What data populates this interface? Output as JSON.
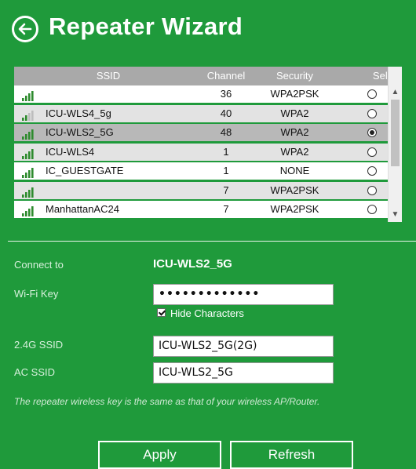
{
  "header": {
    "title": "Repeater Wizard",
    "back_icon": "back-arrow-icon"
  },
  "table": {
    "columns": [
      "SSID",
      "Channel",
      "Security",
      "Select"
    ],
    "rows": [
      {
        "ssid": "",
        "channel": "36",
        "security": "WPA2PSK",
        "selected": false,
        "signal": 4
      },
      {
        "ssid": "ICU-WLS4_5g",
        "channel": "40",
        "security": "WPA2",
        "selected": false,
        "signal": 2
      },
      {
        "ssid": "ICU-WLS2_5G",
        "channel": "48",
        "security": "WPA2",
        "selected": true,
        "signal": 4
      },
      {
        "ssid": "ICU-WLS4",
        "channel": "1",
        "security": "WPA2",
        "selected": false,
        "signal": 4
      },
      {
        "ssid": "IC_GUESTGATE",
        "channel": "1",
        "security": "NONE",
        "selected": false,
        "signal": 4
      },
      {
        "ssid": "",
        "channel": "7",
        "security": "WPA2PSK",
        "selected": false,
        "signal": 4
      },
      {
        "ssid": "ManhattanAC24",
        "channel": "7",
        "security": "WPA2PSK",
        "selected": false,
        "signal": 4
      }
    ]
  },
  "form": {
    "connect_to_label": "Connect to",
    "connect_to_value": "ICU-WLS2_5G",
    "wifi_key_label": "Wi-Fi Key",
    "wifi_key_value": "•••••••••••••",
    "hide_characters_label": "Hide Characters",
    "hide_characters_checked": true,
    "ssid_24g_label": "2.4G SSID",
    "ssid_24g_value": "ICU-WLS2_5G(2G)",
    "ac_ssid_label": "AC SSID",
    "ac_ssid_value": "ICU-WLS2_5G"
  },
  "note": "The repeater wireless key is the same as that of your wireless AP/Router.",
  "buttons": {
    "apply": "Apply",
    "refresh": "Refresh"
  },
  "colors": {
    "background": "#1f9a3b",
    "table_header": "#a9a9a9",
    "row_selected": "#b8b8b8"
  }
}
